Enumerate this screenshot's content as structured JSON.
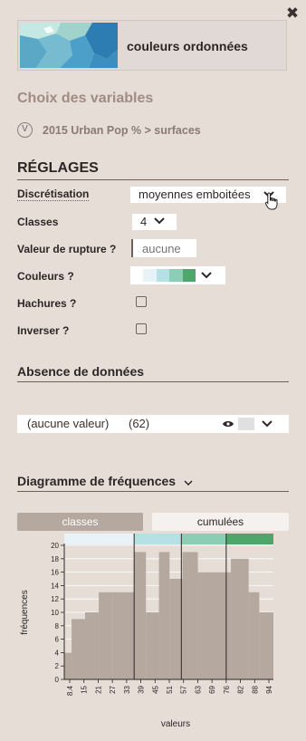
{
  "header": {
    "close_icon": "close-icon",
    "map_title": "couleurs ordonnées"
  },
  "variables": {
    "heading": "Choix des variables",
    "badge": "V",
    "selected": "2015 Urban Pop % > surfaces"
  },
  "settings": {
    "heading": "RÉGLAGES",
    "discretisation": {
      "label": "Discrétisation",
      "value": "moyennes emboitées"
    },
    "classes": {
      "label": "Classes",
      "value": "4"
    },
    "breakpoint": {
      "label": "Valeur de rupture ?",
      "placeholder": "aucune"
    },
    "colors": {
      "label": "Couleurs ?",
      "swatches": [
        "#e7f3f7",
        "#b6e1e4",
        "#8ccdb5",
        "#4fa66b"
      ]
    },
    "hatching": {
      "label": "Hachures ?"
    },
    "invert": {
      "label": "Inverser ?"
    }
  },
  "missing": {
    "heading": "Absence de données",
    "label": "(aucune valeur)",
    "count": "(62)",
    "swatch": "#e0e0e0"
  },
  "frequency": {
    "heading": "Diagramme de fréquences",
    "tabs": [
      {
        "label": "classes",
        "active": true
      },
      {
        "label": "cumulées",
        "active": false
      }
    ]
  },
  "chart_data": {
    "type": "bar",
    "xlabel": "valeurs",
    "ylabel": "fréquences",
    "ylim": [
      0,
      20
    ],
    "yticks": [
      0,
      2,
      4,
      6,
      8,
      10,
      12,
      14,
      16,
      18,
      20
    ],
    "xticks": [
      "8.4",
      "15",
      "21",
      "27",
      "33",
      "39",
      "45",
      "51",
      "57",
      "63",
      "69",
      "76",
      "82",
      "88",
      "94"
    ],
    "bin_edges": [
      8.4,
      11.5,
      17.2,
      23,
      29,
      38,
      43,
      48.5,
      53,
      58.5,
      65,
      77,
      79,
      86.5,
      91,
      97
    ],
    "values": [
      4,
      9,
      10,
      13,
      13,
      19,
      10,
      19,
      15,
      19,
      16,
      16,
      18,
      13,
      10
    ],
    "class_breaks": [
      38,
      58,
      77
    ],
    "class_colors": [
      "#e7f3f7",
      "#b6e1e4",
      "#8ccdb5",
      "#4fa66b"
    ],
    "bar_color": "#b5a89e"
  }
}
